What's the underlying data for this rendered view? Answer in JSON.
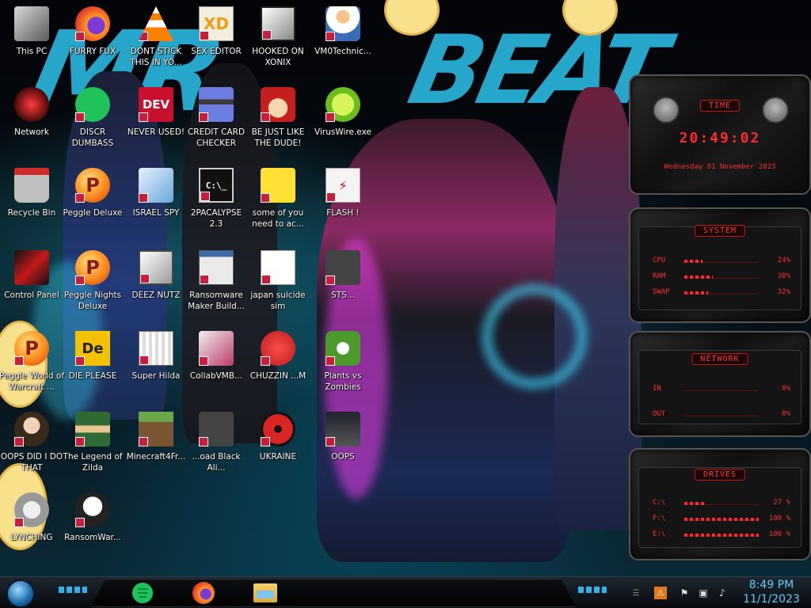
{
  "desktop": {
    "icons": [
      {
        "label": "This PC",
        "icon": "computer-icon"
      },
      {
        "label": "FURRY FUX",
        "icon": "firefox-icon"
      },
      {
        "label": "DONT STICK THIS IN YO...",
        "icon": "vlc-icon"
      },
      {
        "label": "SEX EDITOR",
        "icon": "xd-editor-icon"
      },
      {
        "label": "HOOKED ON XONIX",
        "icon": "xonix-game-icon"
      },
      {
        "label": "VM0Technic...",
        "icon": "technician-icon"
      },
      {
        "label": "Network",
        "icon": "network-icon"
      },
      {
        "label": "DISCR DUMBASS",
        "icon": "green-app-icon"
      },
      {
        "label": "NEVER USED!",
        "icon": "devcpp-icon"
      },
      {
        "label": "CREDIT CARD CHECKER",
        "icon": "credit-card-icon"
      },
      {
        "label": "BE JUST LIKE THE DUDE!",
        "icon": "santa-icon"
      },
      {
        "label": "VirusWire.exe",
        "icon": "lime-icon"
      },
      {
        "label": "Recycle Bin",
        "icon": "recycle-bin-icon"
      },
      {
        "label": "Peggle Deluxe",
        "icon": "peggle-icon"
      },
      {
        "label": "ISRAEL SPY",
        "icon": "spy-icon"
      },
      {
        "label": "2PACALYPSE 2.3",
        "icon": "terminal-icon"
      },
      {
        "label": "some of you need to ac...",
        "icon": "beaver-icon"
      },
      {
        "label": "FLASH !",
        "icon": "flash-icon"
      },
      {
        "label": "Control Panel",
        "icon": "control-panel-icon"
      },
      {
        "label": "Peggle Nights Deluxe",
        "icon": "peggle-icon"
      },
      {
        "label": "DEEZ NUTZ",
        "icon": "windows-stack-icon"
      },
      {
        "label": "Ransomware Maker Build...",
        "icon": "window-app-icon"
      },
      {
        "label": "japan suicide sim",
        "icon": "document-icon"
      },
      {
        "label": "STS...",
        "icon": "app-icon"
      },
      {
        "label": "Peggle World of Warcraft ...",
        "icon": "peggle-icon"
      },
      {
        "label": "DIE PLEASE",
        "icon": "die-icon"
      },
      {
        "label": "Super Hilda",
        "icon": "pixel-art-icon"
      },
      {
        "label": "CollabVMB...",
        "icon": "collabvm-icon"
      },
      {
        "label": "CHUZZIN ...M",
        "icon": "chuzzle-icon"
      },
      {
        "label": "Plants vs Zombies",
        "icon": "plants-icon"
      },
      {
        "label": "OOPS DID I DO THAT",
        "icon": "portrait-icon"
      },
      {
        "label": "The Legend of Zilda",
        "icon": "zelda-icon"
      },
      {
        "label": "Minecraft4Fr...",
        "icon": "minecraft-icon"
      },
      {
        "label": "...oad Black Ali...",
        "icon": "app-icon"
      },
      {
        "label": "UKRAINE",
        "icon": "radiation-icon"
      },
      {
        "label": "OOPS",
        "icon": "recorder-icon"
      },
      {
        "label": "LYNCHING",
        "icon": "gear-flag-icon"
      },
      {
        "label": "RansomWar...",
        "icon": "skull-icon"
      }
    ]
  },
  "gadgets": {
    "time": {
      "caption": "TIME",
      "clock": "20:49:02",
      "date": "Wednesday 01 November 2023"
    },
    "system": {
      "caption": "SYSTEM",
      "rows": [
        {
          "label": "CPU",
          "value": "24%",
          "level": 0.24
        },
        {
          "label": "RAM",
          "value": "38%",
          "level": 0.38
        },
        {
          "label": "SWAP",
          "value": "32%",
          "level": 0.32
        }
      ]
    },
    "network": {
      "caption": "NETWORK",
      "rows": [
        {
          "label": "IN",
          "value": "0%",
          "level": 0
        },
        {
          "label": "OUT",
          "value": "0%",
          "level": 0
        }
      ]
    },
    "drives": {
      "caption": "DRIVES",
      "rows": [
        {
          "label": "C:\\",
          "value": "27 %",
          "level": 0.27
        },
        {
          "label": "F:\\",
          "value": "100 %",
          "level": 1.0
        },
        {
          "label": "E:\\",
          "value": "100 %",
          "level": 1.0
        }
      ]
    }
  },
  "taskbar": {
    "pinned": [
      {
        "name": "green-app-icon"
      },
      {
        "name": "firefox-icon"
      },
      {
        "name": "file-explorer-icon"
      }
    ],
    "tray": [
      "shield-icon",
      "flag-icon",
      "network-tray-icon",
      "volume-icon"
    ],
    "time": "8:49 PM",
    "date": "11/1/2023"
  },
  "colors": {
    "gadget_red": "#ff3030",
    "clock_blue": "#5dd0ff",
    "wallpaper_cyan": "#2bb8e0",
    "shortcut_badge": "#c81d3b"
  }
}
